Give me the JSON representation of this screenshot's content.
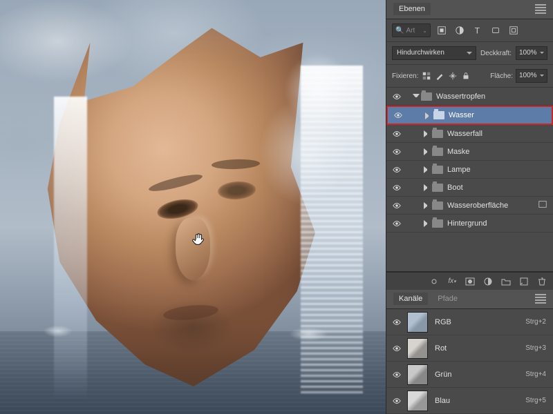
{
  "panels": {
    "layers_tab": "Ebenen",
    "channels_tab": "Kanäle",
    "paths_tab": "Pfade"
  },
  "search": {
    "prefix": "𝒫",
    "label": "Art"
  },
  "blend": {
    "mode": "Hindurchwirken",
    "opacity_label": "Deckkraft:",
    "opacity": "100%"
  },
  "lock": {
    "label": "Fixieren:",
    "fill_label": "Fläche:",
    "fill": "100%"
  },
  "layers": [
    {
      "name": "Wassertropfen",
      "indent": 0,
      "open": true,
      "selected": false
    },
    {
      "name": "Wasser",
      "indent": 1,
      "open": false,
      "selected": true
    },
    {
      "name": "Wasserfall",
      "indent": 1,
      "open": false,
      "selected": false
    },
    {
      "name": "Maske",
      "indent": 1,
      "open": false,
      "selected": false
    },
    {
      "name": "Lampe",
      "indent": 1,
      "open": false,
      "selected": false
    },
    {
      "name": "Boot",
      "indent": 1,
      "open": false,
      "selected": false
    },
    {
      "name": "Wasseroberfläche",
      "indent": 1,
      "open": false,
      "selected": false,
      "extra": true
    },
    {
      "name": "Hintergrund",
      "indent": 1,
      "open": false,
      "selected": false
    }
  ],
  "channels": [
    {
      "name": "RGB",
      "shortcut": "Strg+2",
      "thumb": "rgb"
    },
    {
      "name": "Rot",
      "shortcut": "Strg+3",
      "thumb": "r"
    },
    {
      "name": "Grün",
      "shortcut": "Strg+4",
      "thumb": "g"
    },
    {
      "name": "Blau",
      "shortcut": "Strg+5",
      "thumb": "b"
    }
  ]
}
